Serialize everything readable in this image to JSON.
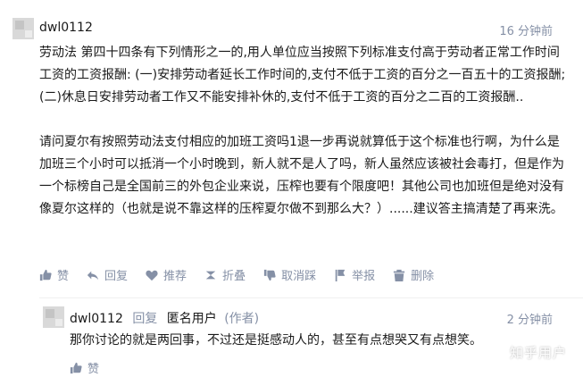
{
  "comment": {
    "author": "dwl0112",
    "time": "16 分钟前",
    "paragraph1": "劳动法 第四十四条有下列情形之一的,用人单位应当按照下列标准支付高于劳动者正常工作时间工资的工资报酬: (一)安排劳动者延长工作时间的,支付不低于工资的百分之一百五十的工资报酬; (二)休息日安排劳动者工作又不能安排补休的,支付不低于工资的百分之二百的工资报酬..",
    "paragraph2": "请问夏尔有按照劳动法支付相应的加班工资吗1退一步再说就算低于这个标准也行啊，为什么是加班三个小时可以抵消一个小时晚到，新人就不是人了吗，新人虽然应该被社会毒打，但是作为一个标榜自己是全国前三的外包企业来说，压榨也要有个限度吧！其他公司也加班但是绝对没有像夏尔这样的（也就是说不靠这样的压榨夏尔做不到那么大？）......建议答主搞清楚了再来洗。",
    "actions": {
      "like": "赞",
      "reply": "回复",
      "recommend": "推荐",
      "fold": "折叠",
      "unlike": "取消踩",
      "report": "举报",
      "delete": "删除"
    }
  },
  "reply": {
    "author": "dwl0112",
    "reply_label": "回复",
    "target": "匿名用户",
    "target_tag": "(作者)",
    "time": "2 分钟前",
    "text": "那你讨论的就是两回事，不过还是挺感动人的，甚至有点想哭又有点想笑。",
    "like": "赞"
  },
  "watermark": "知乎用户",
  "colors": {
    "meta": "#8590a6",
    "text": "#1a1a1a"
  }
}
